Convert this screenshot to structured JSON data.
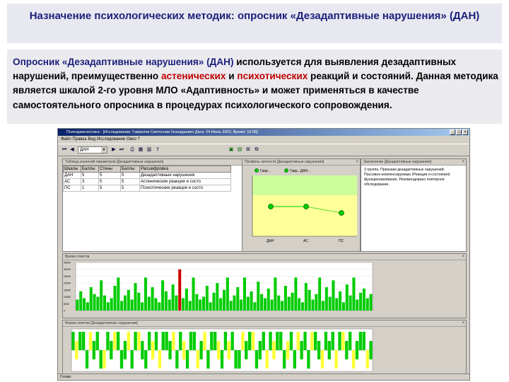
{
  "slide": {
    "title": "Назначение психологических методик: опросник «Дезадаптивные нарушения» (ДАН)",
    "description": {
      "part1": "Опросник «Дезадаптивные нарушения» (ДАН)",
      "part2": " используется для выявления дезадаптивных нарушений, преимущественно ",
      "part3": "астенических",
      "part4": " и ",
      "part5": "психотических",
      "part6": " реакций и состояний. Данная методика является шкалой 2-го уровня МЛО «Адаптивность» и может применяться в качестве самостоятельного опросника в процедурах психологического сопровождения."
    }
  },
  "app": {
    "window_title": "Психодиагностика - [Исследование: Гаврилов Святослав Геннадьевич Дата: 24 Июль 2003, Время: 16:08]",
    "menu": "Файл  Правка  Вид  Исследование  Окно  ?",
    "combo_value": "ДАН",
    "colors": {
      "green": "#00cc00",
      "red": "#cc0000",
      "yellow": "#ffff33",
      "light_green": "#ccff99"
    },
    "scales_panel": {
      "title": "Таблица значений параметров [Дезадаптивные нарушения]",
      "headers": [
        "Шкалы",
        "Баллы",
        "Стены",
        "Баллы",
        "Расшифровка"
      ],
      "rows": [
        [
          "ДАН",
          "5",
          "5",
          "5",
          "Дезадаптивные нарушения"
        ],
        [
          "АС",
          "3",
          "5",
          "5",
          "Астенические реакции и состо"
        ],
        [
          "ПС",
          "1",
          "5",
          "5",
          "Психотические реакции и состо"
        ]
      ]
    },
    "profile_panel": {
      "title": "Профиль личности [Дезадаптивные нарушения]",
      "legend_a": "Гавр...",
      "legend_b": "Гавр...ДАН...",
      "x_ticks": [
        "ДАН",
        "АС",
        "ПС"
      ]
    },
    "conclusion_panel": {
      "title": "Заключение [Дезадаптивные нарушения]",
      "text": "3 группа. Признаки дезадаптивных нарушений. Пассивно-компенсируемые (Реакции и состояния) функционирование. Рекомендовано повторное обследование."
    },
    "time_panel": {
      "title": "Время ответов",
      "y_ticks": [
        "35000",
        "30000",
        "25000",
        "20000",
        "15000",
        "10000",
        "5000",
        "0"
      ],
      "chart_data": {
        "type": "bar",
        "ylabel": "",
        "ylim": [
          0,
          35000
        ],
        "values": [
          8000,
          14000,
          9000,
          6000,
          17000,
          12000,
          10000,
          22000,
          11000,
          6000,
          9000,
          18000,
          24000,
          7000,
          11000,
          15000,
          8000,
          20000,
          13000,
          6000,
          24000,
          10000,
          17000,
          9000,
          6000,
          22000,
          14000,
          8000,
          19000,
          11000,
          30000,
          9000,
          16000,
          7000,
          24000,
          12000,
          8000,
          10000,
          18000,
          6000,
          13000,
          20000,
          9000,
          15000,
          24000,
          7000,
          11000,
          17000,
          8000,
          24000,
          10000,
          14000,
          6000,
          21000,
          12000,
          9000,
          16000,
          8000,
          24000,
          11000,
          7000,
          18000,
          10000,
          13000,
          24000,
          9000,
          6000,
          20000,
          15000,
          8000,
          12000,
          24000,
          7000,
          17000,
          10000,
          22000,
          9000,
          14000,
          6000,
          19000,
          11000,
          24000,
          8000,
          13000,
          16000,
          9000,
          12000
        ],
        "highlight_index": 30
      }
    },
    "state_panel": {
      "title": "Форма ответов [Дезадаптивные нарушения]",
      "chart_data": {
        "type": "bar",
        "levels": [
          1,
          0,
          1,
          1,
          -1,
          1,
          0,
          1,
          -1,
          -1,
          1,
          0,
          1,
          1,
          -1,
          0,
          1,
          -1,
          1,
          1,
          0,
          -1,
          1,
          0,
          1,
          -1,
          1,
          1,
          0,
          1,
          -1,
          1,
          0,
          -1,
          1,
          1,
          -1,
          0,
          1,
          -1,
          1,
          1,
          0,
          -1,
          1,
          0,
          1,
          -1,
          -1,
          1,
          0,
          1,
          1,
          -1,
          0,
          1,
          -1,
          1,
          0,
          1,
          1,
          -1,
          0,
          1,
          -1,
          1,
          0,
          1,
          -1,
          1,
          1,
          0,
          -1,
          1,
          0,
          1,
          -1,
          1,
          1,
          0,
          1,
          -1,
          0,
          1,
          1,
          -1,
          0
        ],
        "kinds": [
          "g",
          "y",
          "g",
          "g",
          "g",
          "y",
          "g",
          "g",
          "g",
          "y",
          "g",
          "g",
          "y",
          "g",
          "g",
          "g",
          "y",
          "g",
          "g",
          "y",
          "g",
          "g",
          "g",
          "y",
          "g",
          "y",
          "g",
          "g",
          "g",
          "y",
          "g",
          "g",
          "y",
          "g",
          "g",
          "g",
          "y",
          "g",
          "y",
          "g",
          "g",
          "g",
          "y",
          "g",
          "g",
          "y",
          "g",
          "g",
          "g",
          "y",
          "g",
          "g",
          "y",
          "g",
          "g",
          "g",
          "y",
          "g",
          "y",
          "g",
          "g",
          "g",
          "y",
          "g",
          "g",
          "y",
          "g",
          "g",
          "g",
          "y",
          "g",
          "g",
          "y",
          "g",
          "g",
          "g",
          "y",
          "g",
          "y",
          "g",
          "g",
          "y",
          "g",
          "g",
          "g",
          "y",
          "g"
        ]
      }
    },
    "status_text": "Готово"
  }
}
